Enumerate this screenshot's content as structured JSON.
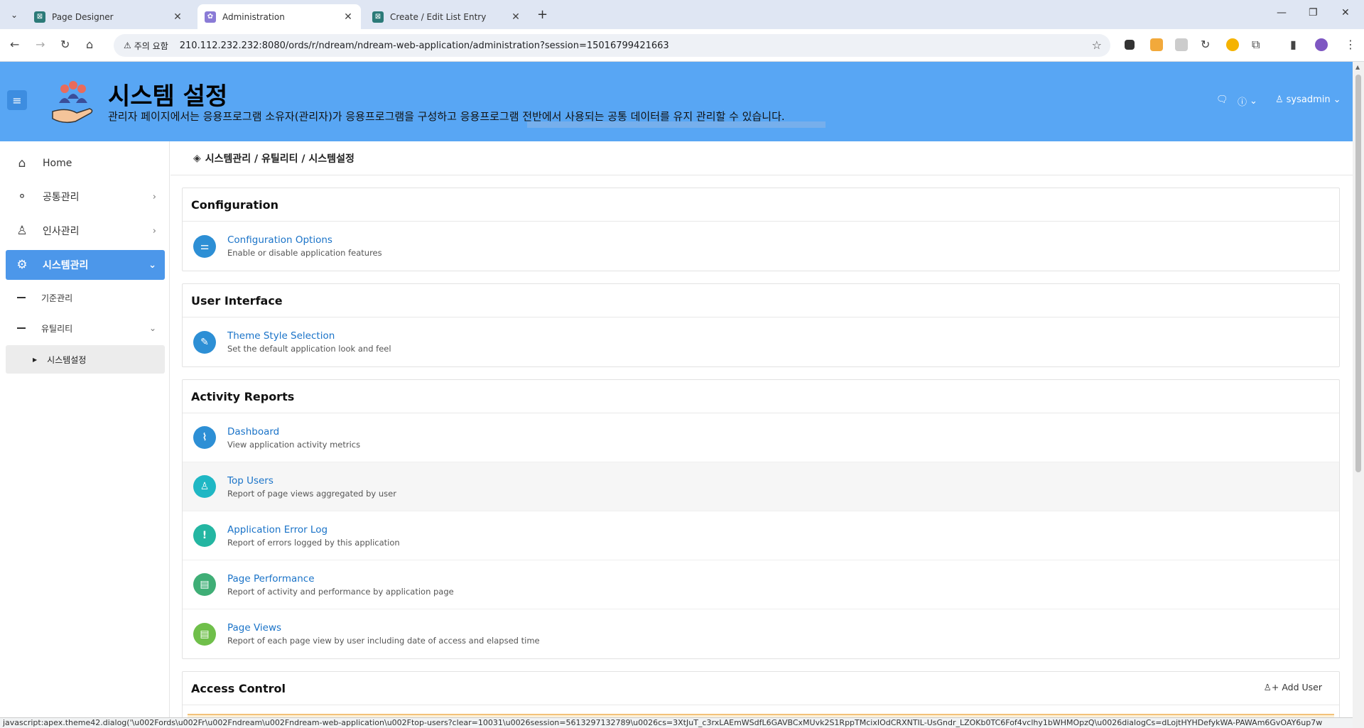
{
  "browser": {
    "tabs": [
      {
        "title": "Page Designer",
        "favicon": "apex-icon"
      },
      {
        "title": "Administration",
        "favicon": "admin-icon"
      },
      {
        "title": "Create / Edit List Entry",
        "favicon": "apex-icon"
      }
    ],
    "security_label": "주의 요함",
    "url": "210.112.232.232:8080/ords/r/ndream/ndream-web-application/administration?session=15016799421663"
  },
  "header": {
    "title": "시스템 설정",
    "subtitle": "관리자 페이지에서는 응용프로그램 소유자(관리자)가 응용프로그램을 구성하고 응용프로그램 전반에서 사용되는 공통 데이터를 유지 관리할 수 있습니다.",
    "user": "sysadmin"
  },
  "sidebar": {
    "items": [
      {
        "label": "Home",
        "icon": "home-icon"
      },
      {
        "label": "공통관리",
        "icon": "share-nodes-icon"
      },
      {
        "label": "인사관리",
        "icon": "users-icon"
      },
      {
        "label": "시스템관리",
        "icon": "gear-icon"
      }
    ],
    "sub_items": [
      {
        "label": "기준관리"
      },
      {
        "label": "유틸리티"
      }
    ],
    "sub_sub_items": [
      {
        "label": "시스템설정"
      }
    ]
  },
  "breadcrumb": "시스템관리 / 유틸리티 / 시스템설정",
  "regions": {
    "configuration": {
      "title": "Configuration",
      "rows": [
        {
          "title": "Configuration Options",
          "desc": "Enable or disable application features",
          "icon": "sliders-icon",
          "color": "#2d8fd5"
        }
      ]
    },
    "user_interface": {
      "title": "User Interface",
      "rows": [
        {
          "title": "Theme Style Selection",
          "desc": "Set the default application look and feel",
          "icon": "brush-icon",
          "color": "#2d8fd5"
        }
      ]
    },
    "activity_reports": {
      "title": "Activity Reports",
      "rows": [
        {
          "title": "Dashboard",
          "desc": "View application activity metrics",
          "icon": "chart-icon",
          "color": "#2d8fd5"
        },
        {
          "title": "Top Users",
          "desc": "Report of page views aggregated by user",
          "icon": "user-chart-icon",
          "color": "#1fb7c4"
        },
        {
          "title": "Application Error Log",
          "desc": "Report of errors logged by this application",
          "icon": "exclamation-icon",
          "color": "#24b6a2"
        },
        {
          "title": "Page Performance",
          "desc": "Report of activity and performance by application page",
          "icon": "file-chart-icon",
          "color": "#3fae76"
        },
        {
          "title": "Page Views",
          "desc": "Report of each page view by user including date of access and elapsed time",
          "icon": "file-search-icon",
          "color": "#6fbf4a"
        }
      ]
    },
    "access_control": {
      "title": "Access Control",
      "add_user_label": "Add User"
    }
  },
  "statusbar": "javascript:apex.theme42.dialog('\\u002Fords\\u002Fr\\u002Fndream\\u002Fndream-web-application\\u002Ftop-users?clear=10031\\u0026session=5613297132789\\u0026cs=3XtJuT_c3rxLAEmWSdfL6GAVBCxMUvk2S1RppTMcixIOdCRXNTIL-UsGndr_LZOKb0TC6Fof4vclhy1bWHMOpzQ\\u0026dialogCs=dLojtHYHDefykWA-PAWAm6GvOAY6up7w"
}
